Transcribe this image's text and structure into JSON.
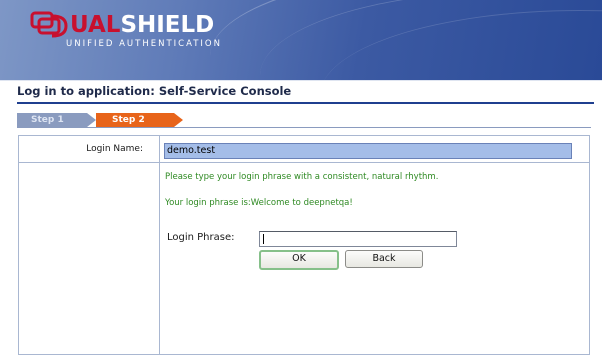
{
  "header": {
    "logo_prefix": "D",
    "logo_red": "UAL",
    "logo_white": "SHIELD",
    "logo_tagline": "UNIFIED AUTHENTICATION",
    "colors": {
      "banner": "#3c5aa3",
      "logo_red": "#c8102e"
    }
  },
  "page": {
    "title": "Log in to application: Self-Service Console"
  },
  "steps": [
    {
      "label": "Step 1",
      "state": "completed"
    },
    {
      "label": "Step 2",
      "state": "current"
    }
  ],
  "form": {
    "login_name_label": "Login Name:",
    "login_name_value": "demo.test",
    "instruction": "Please type your login phrase with a consistent, natural rhythm.",
    "phrase_prompt": "Your login phrase is:Welcome to deepnetqa!",
    "login_phrase_label": "Login Phrase:",
    "login_phrase_value": "",
    "ok_label": "OK",
    "back_label": "Back"
  }
}
